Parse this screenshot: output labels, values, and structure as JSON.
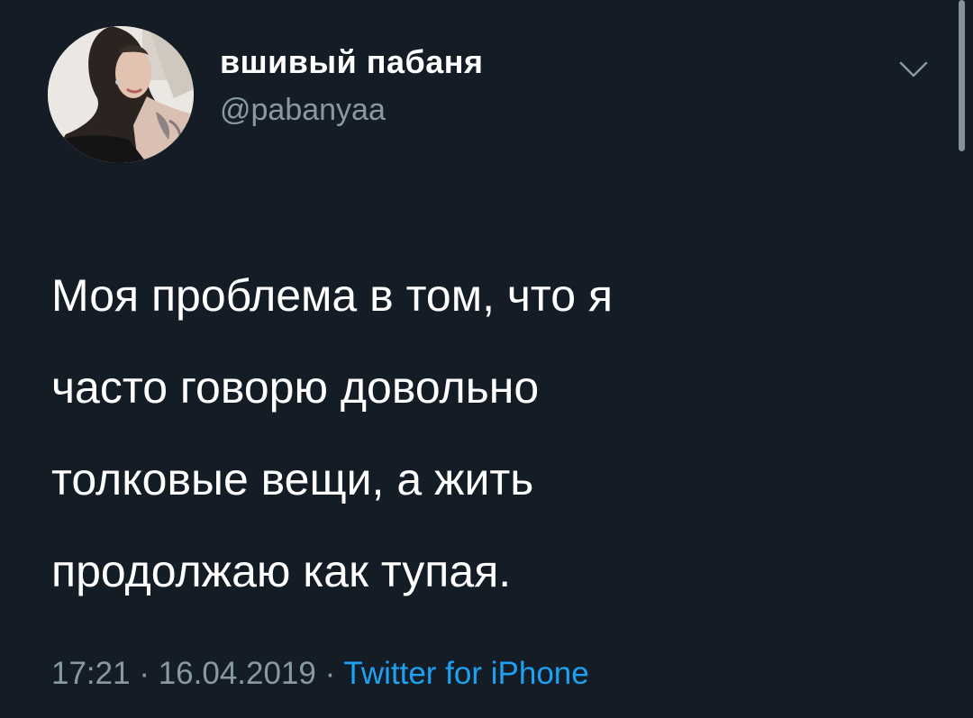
{
  "user": {
    "display_name": "вшивый пабаня",
    "handle": "@pabanyaa"
  },
  "menu": {
    "icon": "chevron-down-icon"
  },
  "tweet": {
    "lines": [
      "Моя проблема в том, что я",
      "часто говорю довольно",
      "толковые вещи, а жить",
      "продолжаю как тупая."
    ]
  },
  "meta": {
    "time": "17:21",
    "separator": "·",
    "date": "16.04.2019",
    "source": "Twitter for iPhone"
  },
  "colors": {
    "background": "#141d26",
    "text": "#ffffff",
    "secondary": "#8899a6",
    "link": "#1da1f2"
  }
}
